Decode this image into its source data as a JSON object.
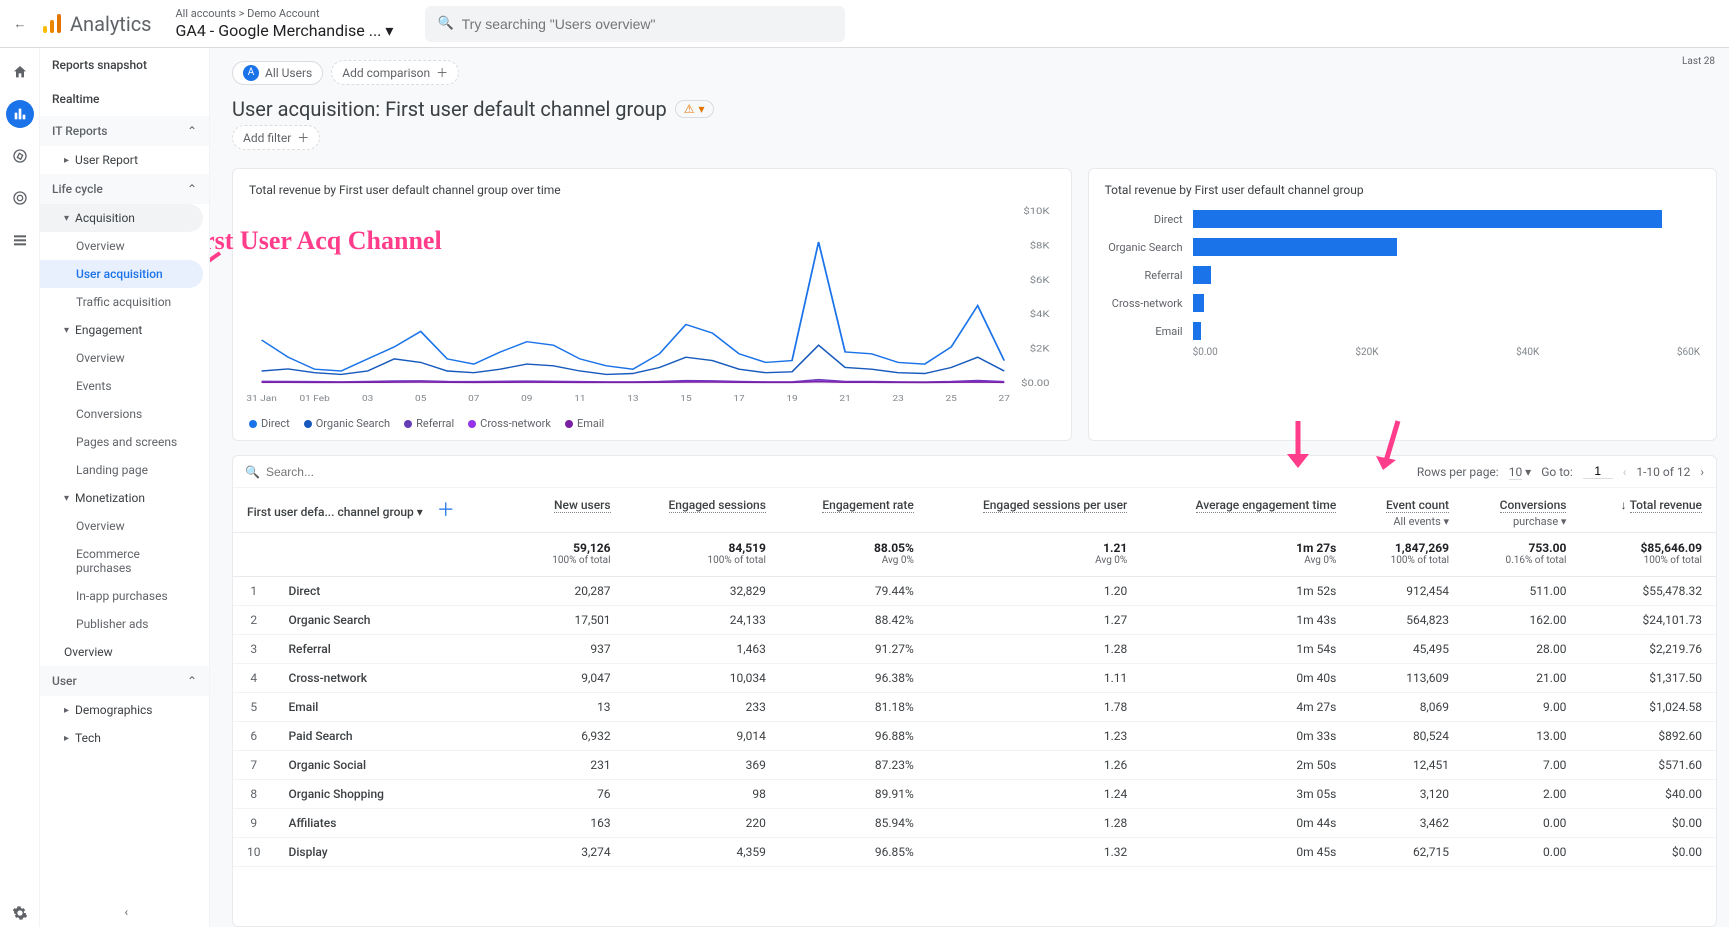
{
  "topbar": {
    "product": "Analytics",
    "breadcrumb_top": "All accounts > Demo Account",
    "breadcrumb_main": "GA4 - Google Merchandise ...",
    "search_placeholder": "Try searching \"Users overview\""
  },
  "date_range": "Last 28",
  "leftnav": {
    "reports_snapshot": "Reports snapshot",
    "realtime": "Realtime",
    "it_reports": "IT Reports",
    "user_report": "User Report",
    "life_cycle": "Life cycle",
    "acquisition": "Acquisition",
    "acq_overview": "Overview",
    "user_acquisition": "User acquisition",
    "traffic_acquisition": "Traffic acquisition",
    "engagement": "Engagement",
    "eng_overview": "Overview",
    "events": "Events",
    "conversions": "Conversions",
    "pages_screens": "Pages and screens",
    "landing_page": "Landing page",
    "monetization": "Monetization",
    "mon_overview": "Overview",
    "ecommerce_purchases": "Ecommerce purchases",
    "inapp_purchases": "In-app purchases",
    "publisher_ads": "Publisher ads",
    "retention_overview": "Overview",
    "user": "User",
    "demographics": "Demographics",
    "tech": "Tech"
  },
  "chips": {
    "all_users_badge": "A",
    "all_users": "All Users",
    "add_comparison": "Add comparison",
    "add_filter": "Add filter"
  },
  "report": {
    "title": "User acquisition: First user default channel group"
  },
  "annotations": {
    "main": "First User Acq Channel"
  },
  "card1": {
    "title": "Total revenue by First user default channel group over time"
  },
  "card2": {
    "title": "Total revenue by First user default channel group"
  },
  "chart_data": [
    {
      "type": "line",
      "title": "Total revenue by First user default channel group over time",
      "xlabel": "",
      "ylabel": "",
      "ylim": [
        0,
        10000
      ],
      "y_ticks": [
        "$0.00",
        "$2K",
        "$4K",
        "$6K",
        "$8K",
        "$10K"
      ],
      "x_ticks": [
        "31 Jan",
        "01 Feb",
        "03",
        "05",
        "07",
        "09",
        "11",
        "13",
        "15",
        "17",
        "19",
        "21",
        "23",
        "25",
        "27"
      ],
      "series": [
        {
          "name": "Direct",
          "color": "#1a73e8",
          "values": [
            2500,
            1500,
            800,
            700,
            1400,
            2100,
            3000,
            1400,
            1100,
            1800,
            2400,
            2200,
            1400,
            1000,
            800,
            1700,
            3400,
            2900,
            1700,
            1200,
            1300,
            8200,
            1800,
            1700,
            1200,
            1100,
            2100,
            4500,
            1300
          ]
        },
        {
          "name": "Organic Search",
          "color": "#185abc",
          "values": [
            700,
            820,
            600,
            500,
            700,
            1400,
            1200,
            700,
            600,
            800,
            1100,
            1000,
            700,
            500,
            550,
            900,
            1500,
            1300,
            800,
            600,
            650,
            2200,
            900,
            800,
            600,
            550,
            900,
            1500,
            700
          ]
        },
        {
          "name": "Referral",
          "color": "#673ab7",
          "values": [
            100,
            90,
            80,
            70,
            90,
            120,
            130,
            90,
            80,
            100,
            110,
            100,
            80,
            70,
            70,
            90,
            140,
            130,
            90,
            70,
            70,
            200,
            95,
            90,
            70,
            65,
            95,
            150,
            80
          ]
        },
        {
          "name": "Cross-network",
          "color": "#9334e6",
          "values": [
            60,
            55,
            50,
            45,
            55,
            70,
            75,
            55,
            50,
            60,
            65,
            60,
            50,
            45,
            45,
            55,
            80,
            75,
            55,
            45,
            45,
            110,
            58,
            55,
            45,
            40,
            58,
            85,
            50
          ]
        },
        {
          "name": "Email",
          "color": "#7b1fa2",
          "values": [
            40,
            38,
            35,
            32,
            38,
            48,
            52,
            38,
            35,
            40,
            44,
            40,
            35,
            32,
            32,
            38,
            55,
            52,
            38,
            32,
            32,
            75,
            40,
            38,
            32,
            30,
            40,
            58,
            35
          ]
        }
      ]
    },
    {
      "type": "bar",
      "orientation": "horizontal",
      "title": "Total revenue by First user default channel group",
      "xlabel": "",
      "ylabel": "",
      "xlim": [
        0,
        60000
      ],
      "x_ticks": [
        "$0.00",
        "$20K",
        "$40K",
        "$60K"
      ],
      "categories": [
        "Direct",
        "Organic Search",
        "Referral",
        "Cross-network",
        "Email"
      ],
      "values": [
        55478,
        24102,
        2220,
        1318,
        1025
      ],
      "color": "#1a73e8"
    }
  ],
  "legend": [
    {
      "label": "Direct",
      "color": "#1a73e8"
    },
    {
      "label": "Organic Search",
      "color": "#185abc"
    },
    {
      "label": "Referral",
      "color": "#673ab7"
    },
    {
      "label": "Cross-network",
      "color": "#9334e6"
    },
    {
      "label": "Email",
      "color": "#7b1fa2"
    }
  ],
  "table": {
    "search_placeholder": "Search...",
    "rows_per_page_label": "Rows per page:",
    "rows_per_page_value": "10",
    "goto_label": "Go to:",
    "goto_value": "1",
    "range": "1-10 of 12",
    "headers": {
      "dimension": "First user defa... channel group",
      "new_users": "New users",
      "engaged_sessions": "Engaged sessions",
      "engagement_rate": "Engagement rate",
      "sessions_per_user": "Engaged sessions per user",
      "avg_engagement": "Average engagement time",
      "event_count": "Event count",
      "event_count_sub": "All events",
      "conversions": "Conversions",
      "conversions_sub": "purchase",
      "total_revenue": "Total revenue"
    },
    "totals": {
      "new_users": "59,126",
      "new_users_sub": "100% of total",
      "engaged_sessions": "84,519",
      "engaged_sessions_sub": "100% of total",
      "engagement_rate": "88.05%",
      "engagement_rate_sub": "Avg 0%",
      "sessions_per_user": "1.21",
      "sessions_per_user_sub": "Avg 0%",
      "avg_engagement": "1m 27s",
      "avg_engagement_sub": "Avg 0%",
      "event_count": "1,847,269",
      "event_count_sub": "100% of total",
      "conversions": "753.00",
      "conversions_sub": "0.16% of total",
      "total_revenue": "$85,646.09",
      "total_revenue_sub": "100% of total"
    },
    "rows": [
      {
        "idx": "1",
        "name": "Direct",
        "new_users": "20,287",
        "engaged_sessions": "32,829",
        "engagement_rate": "79.44%",
        "sessions_per_user": "1.20",
        "avg_engagement": "1m 52s",
        "event_count": "912,454",
        "conversions": "511.00",
        "total_revenue": "$55,478.32"
      },
      {
        "idx": "2",
        "name": "Organic Search",
        "new_users": "17,501",
        "engaged_sessions": "24,133",
        "engagement_rate": "88.42%",
        "sessions_per_user": "1.27",
        "avg_engagement": "1m 43s",
        "event_count": "564,823",
        "conversions": "162.00",
        "total_revenue": "$24,101.73"
      },
      {
        "idx": "3",
        "name": "Referral",
        "new_users": "937",
        "engaged_sessions": "1,463",
        "engagement_rate": "91.27%",
        "sessions_per_user": "1.28",
        "avg_engagement": "1m 54s",
        "event_count": "45,495",
        "conversions": "28.00",
        "total_revenue": "$2,219.76"
      },
      {
        "idx": "4",
        "name": "Cross-network",
        "new_users": "9,047",
        "engaged_sessions": "10,034",
        "engagement_rate": "96.38%",
        "sessions_per_user": "1.11",
        "avg_engagement": "0m 40s",
        "event_count": "113,609",
        "conversions": "21.00",
        "total_revenue": "$1,317.50"
      },
      {
        "idx": "5",
        "name": "Email",
        "new_users": "13",
        "engaged_sessions": "233",
        "engagement_rate": "81.18%",
        "sessions_per_user": "1.78",
        "avg_engagement": "4m 27s",
        "event_count": "8,069",
        "conversions": "9.00",
        "total_revenue": "$1,024.58"
      },
      {
        "idx": "6",
        "name": "Paid Search",
        "new_users": "6,932",
        "engaged_sessions": "9,014",
        "engagement_rate": "96.88%",
        "sessions_per_user": "1.23",
        "avg_engagement": "0m 33s",
        "event_count": "80,524",
        "conversions": "13.00",
        "total_revenue": "$892.60"
      },
      {
        "idx": "7",
        "name": "Organic Social",
        "new_users": "231",
        "engaged_sessions": "369",
        "engagement_rate": "87.23%",
        "sessions_per_user": "1.26",
        "avg_engagement": "2m 50s",
        "event_count": "12,451",
        "conversions": "7.00",
        "total_revenue": "$571.60"
      },
      {
        "idx": "8",
        "name": "Organic Shopping",
        "new_users": "76",
        "engaged_sessions": "98",
        "engagement_rate": "89.91%",
        "sessions_per_user": "1.24",
        "avg_engagement": "3m 05s",
        "event_count": "3,120",
        "conversions": "2.00",
        "total_revenue": "$40.00"
      },
      {
        "idx": "9",
        "name": "Affiliates",
        "new_users": "163",
        "engaged_sessions": "220",
        "engagement_rate": "85.94%",
        "sessions_per_user": "1.28",
        "avg_engagement": "0m 44s",
        "event_count": "3,462",
        "conversions": "0.00",
        "total_revenue": "$0.00"
      },
      {
        "idx": "10",
        "name": "Display",
        "new_users": "3,274",
        "engaged_sessions": "4,359",
        "engagement_rate": "96.85%",
        "sessions_per_user": "1.32",
        "avg_engagement": "0m 45s",
        "event_count": "62,715",
        "conversions": "0.00",
        "total_revenue": "$0.00"
      }
    ]
  }
}
